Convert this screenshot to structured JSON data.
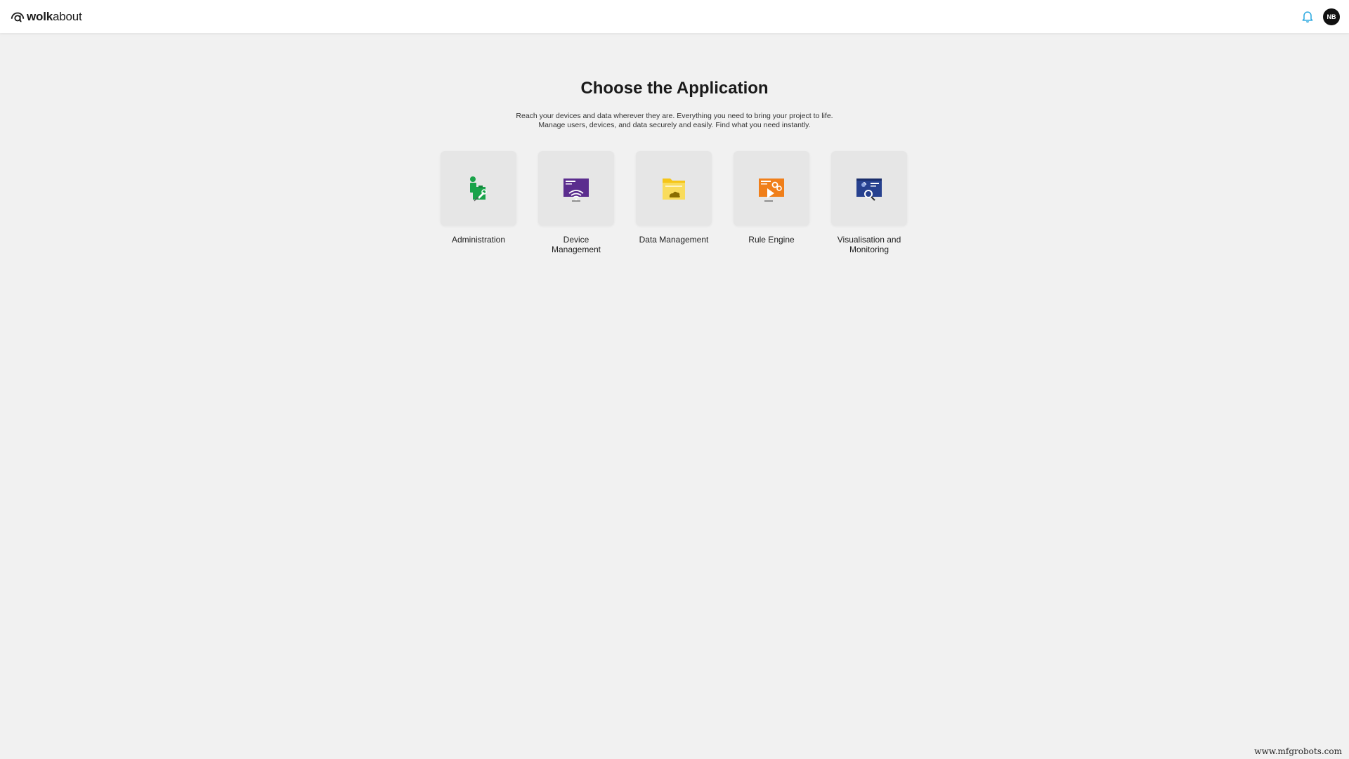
{
  "header": {
    "logo_bold": "wolk",
    "logo_light": "about",
    "logo_icon": "at-sign-icon",
    "notification_icon": "bell-icon",
    "user_initials": "NB",
    "accent_color": "#29a8e0"
  },
  "main": {
    "title": "Choose the Application",
    "subtitle_line1": "Reach your devices and data wherever they are. Everything you need to bring your project to life.",
    "subtitle_line2": "Manage users, devices, and data securely and easily. Find what you need instantly.",
    "apps": [
      {
        "label": "Administration",
        "icon": "administration-icon",
        "color": "#1aa34a"
      },
      {
        "label": "Device Management",
        "icon": "device-management-icon",
        "color": "#5b2d8e"
      },
      {
        "label": "Data Management",
        "icon": "data-management-icon",
        "color": "#f5c518"
      },
      {
        "label": "Rule Engine",
        "icon": "rule-engine-icon",
        "color": "#f07f1a"
      },
      {
        "label": "Visualisation and Monitoring",
        "icon": "visualisation-icon",
        "color": "#27418f"
      }
    ]
  },
  "footer": {
    "watermark": "www.mfgrobots.com"
  }
}
